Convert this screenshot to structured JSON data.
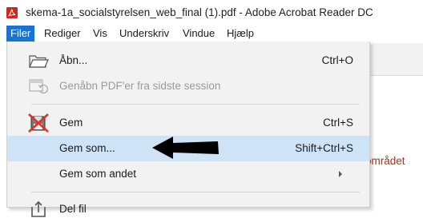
{
  "window": {
    "title": "skema-1a_socialstyrelsen_web_final (1).pdf - Adobe Acrobat Reader DC",
    "icon": "acrobat-reader-icon"
  },
  "menubar": {
    "items": [
      "Filer",
      "Rediger",
      "Vis",
      "Underskriv",
      "Vindue",
      "Hjælp"
    ],
    "active": "Filer"
  },
  "file_menu": {
    "items": [
      {
        "label": "Åbn...",
        "shortcut": "Ctrl+O",
        "icon": "folder-open-icon",
        "enabled": true
      },
      {
        "label": "Genåbn PDF'er fra sidste session",
        "shortcut": "",
        "icon": "reopen-session-icon",
        "enabled": false
      },
      {
        "label": "Gem",
        "shortcut": "Ctrl+S",
        "icon": "save-icon-crossed-out",
        "enabled": true
      },
      {
        "label": "Gem som...",
        "shortcut": "Shift+Ctrl+S",
        "icon": "",
        "enabled": true,
        "highlighted": true
      },
      {
        "label": "Gem som andet",
        "shortcut": "",
        "icon": "",
        "enabled": true,
        "submenu": true
      },
      {
        "label": "Del fil",
        "shortcut": "",
        "icon": "share-icon",
        "enabled": true
      }
    ]
  },
  "background": {
    "document_text": "området"
  },
  "annotation": {
    "type": "black-arrow",
    "points_to": "Gem som..."
  },
  "colors": {
    "menu_active": "#1874cf",
    "menu_highlight": "#cfe3f6",
    "dropdown_bg": "#f2f2f2",
    "cross_red": "#e0322c",
    "acrobat_red": "#d0261d"
  }
}
